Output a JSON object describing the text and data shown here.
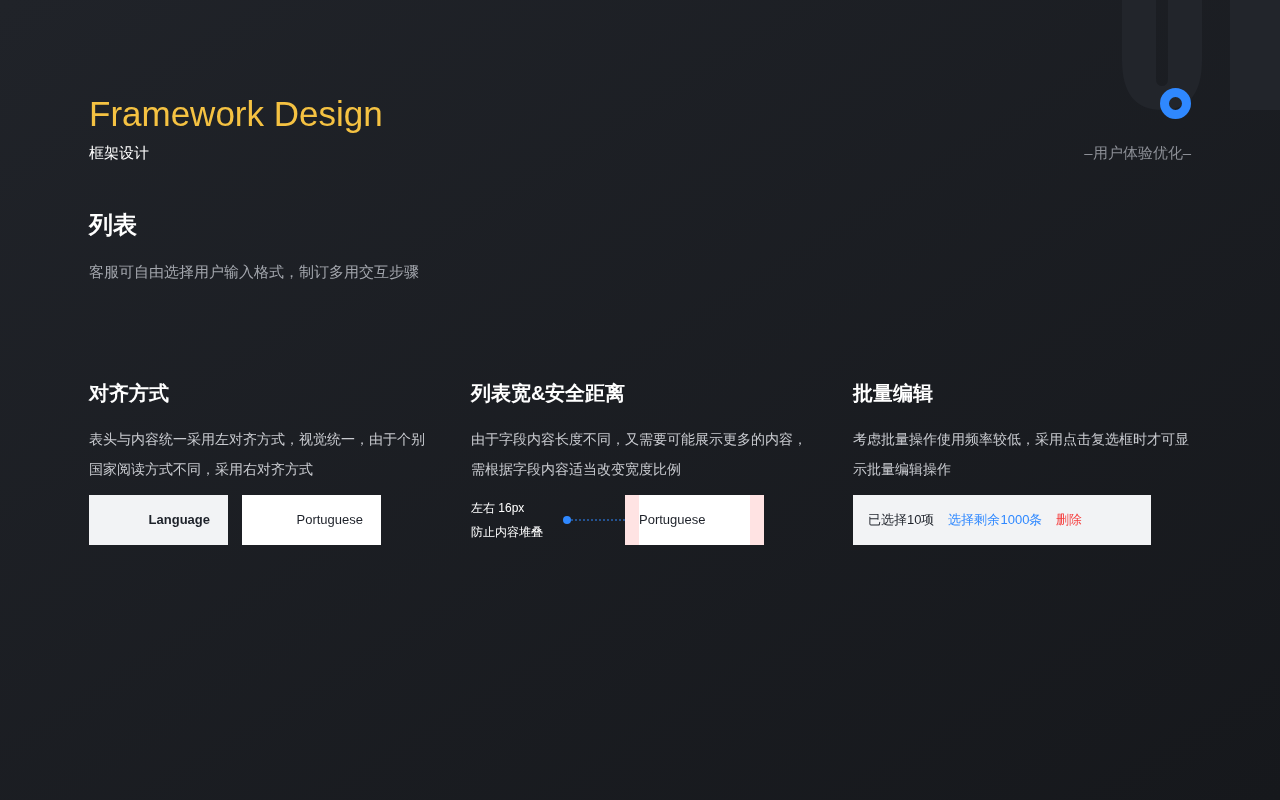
{
  "header": {
    "title": "Framework Design",
    "subtitle": "框架设计",
    "tagline": "–用户体验优化–"
  },
  "section": {
    "title": "列表",
    "description": "客服可自由选择用户输入格式，制订多用交互步骤"
  },
  "columns": [
    {
      "kind": "alignment",
      "title": "对齐方式",
      "description": "表头与内容统一采用左对齐方式，视觉统一，由于个别国家阅读方式不同，采用右对齐方式",
      "header_cell": "Language",
      "body_cell": "Portuguese"
    },
    {
      "kind": "padding",
      "title": "列表宽&安全距离",
      "description": "由于字段内容长度不同，又需要可能展示更多的内容，需根据字段内容适当改变宽度比例",
      "note_lines": [
        "左右 16px",
        "防止内容堆叠"
      ],
      "body_cell": "Portuguese"
    },
    {
      "kind": "batch",
      "title": "批量编辑",
      "description": "考虑批量操作使用频率较低，采用点击复选框时才可显示批量编辑操作",
      "count_label": "已选择10项",
      "select_all_link": "选择剩余1000条",
      "delete_link": "删除"
    }
  ]
}
